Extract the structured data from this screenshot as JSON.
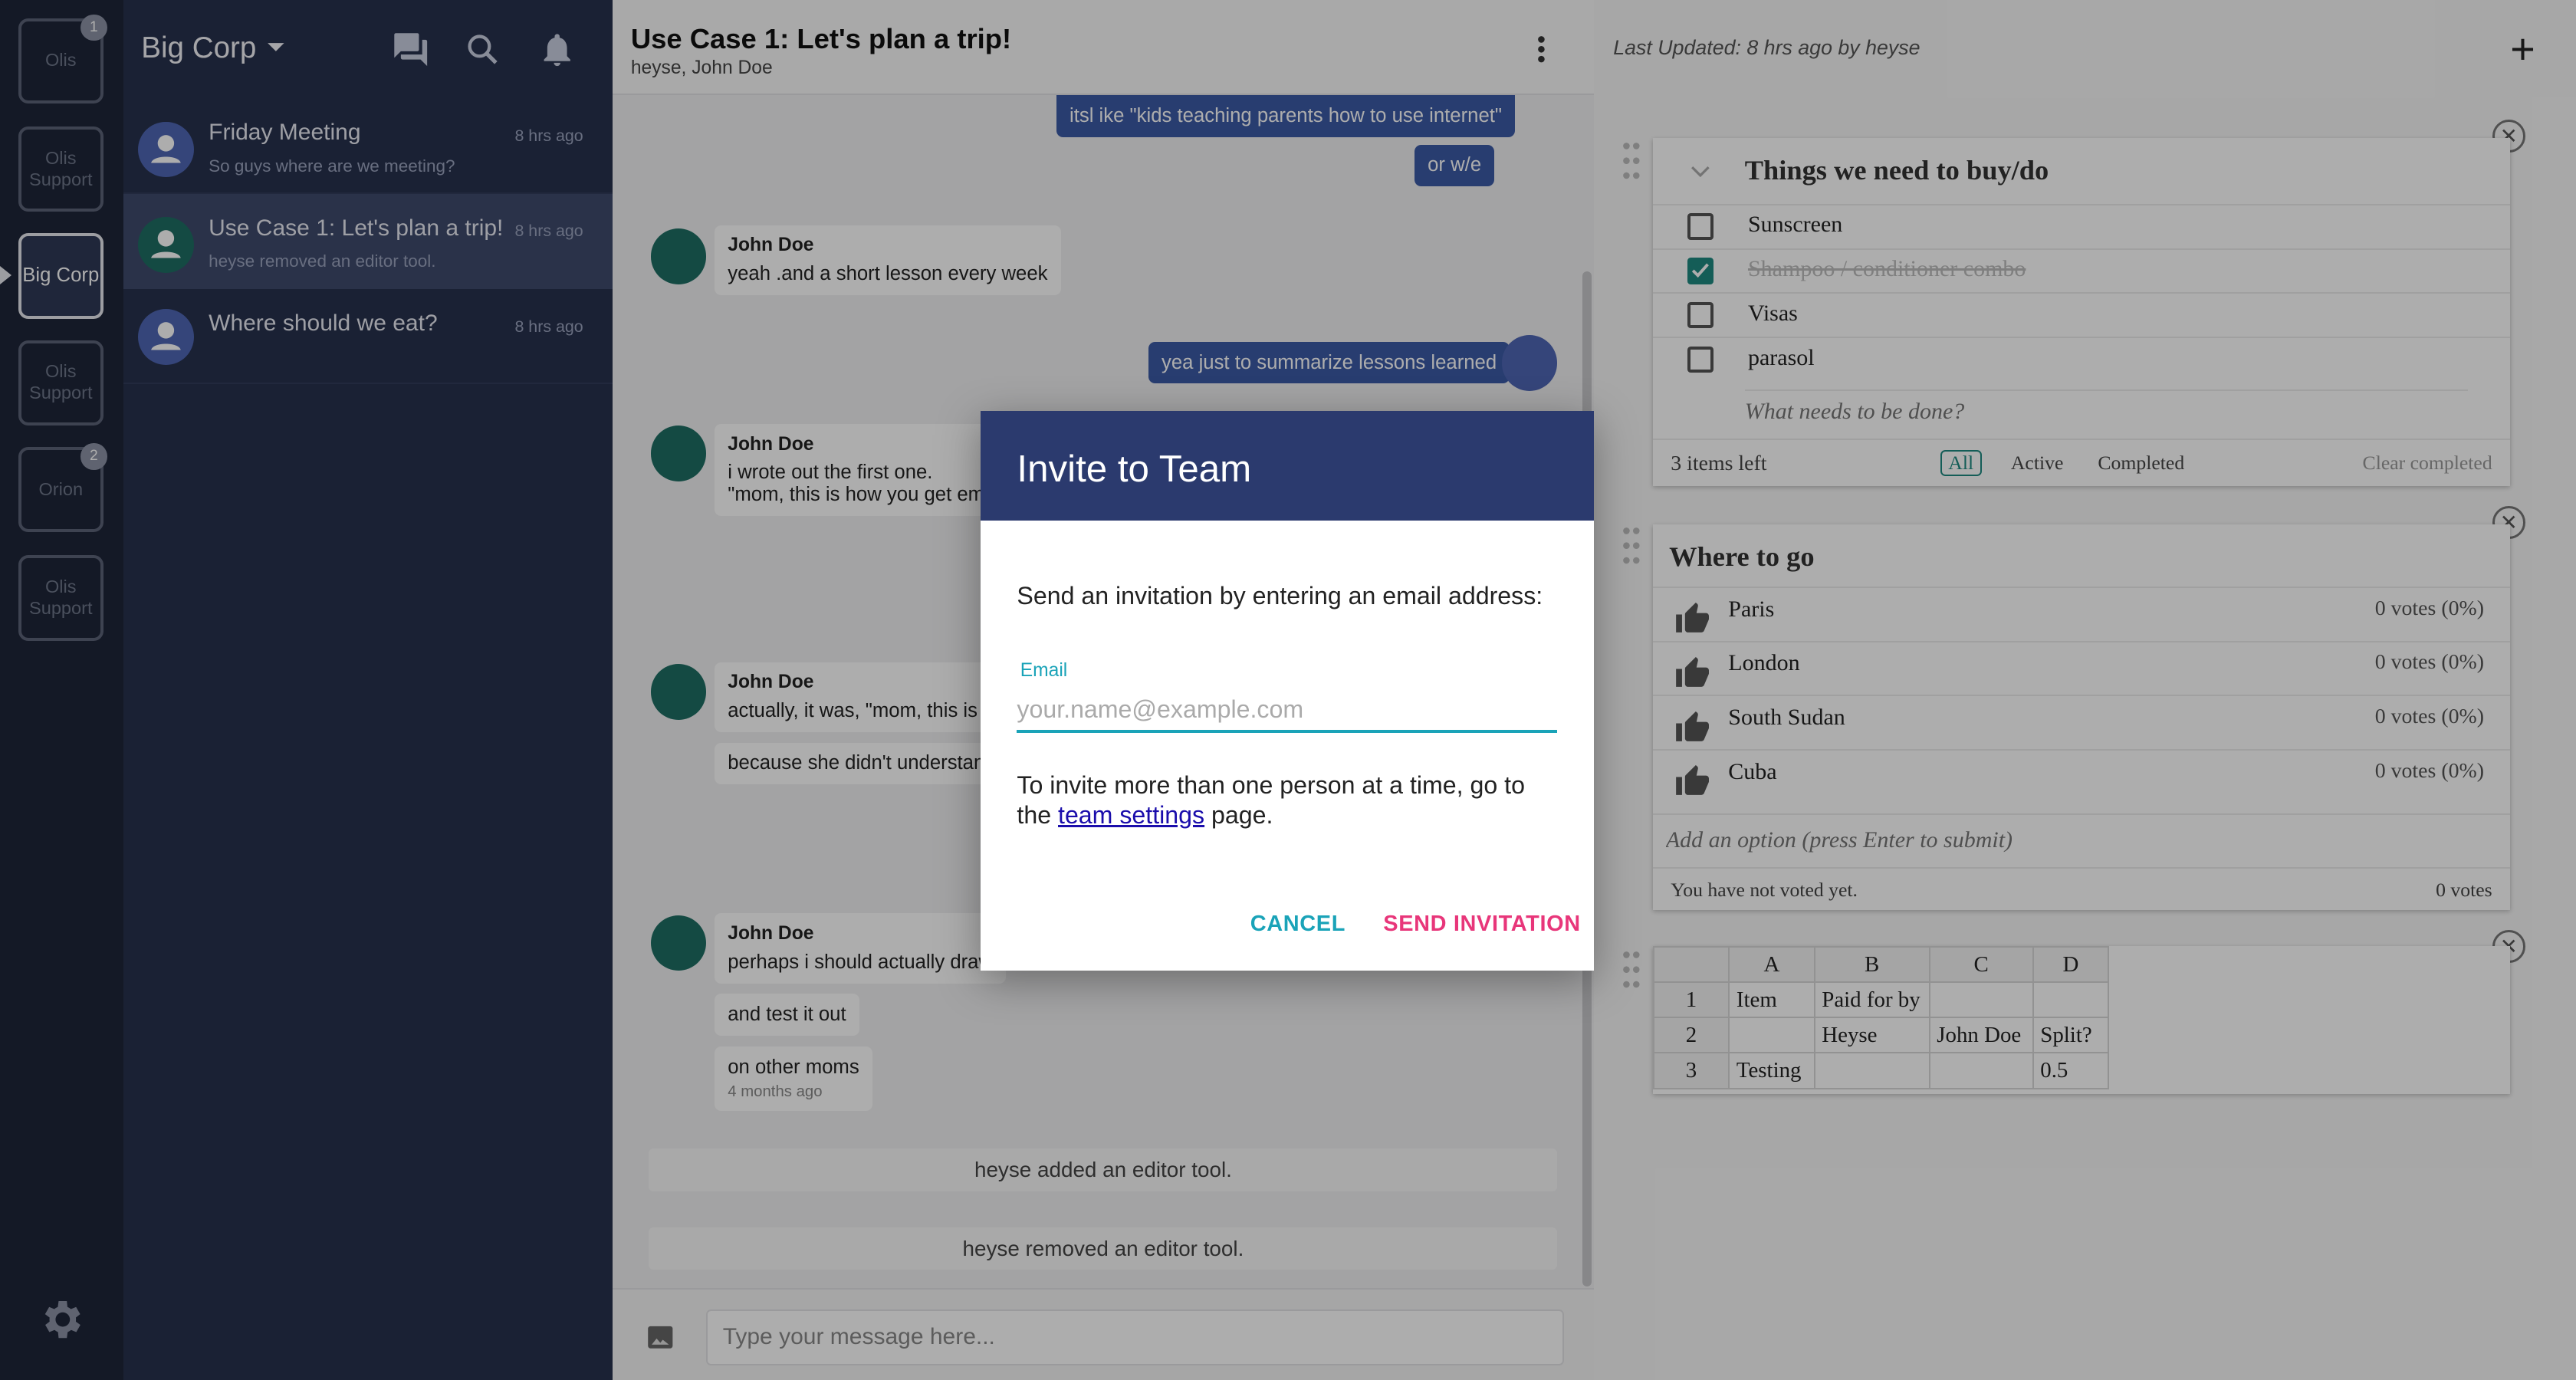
{
  "teams": [
    {
      "label": "Olis",
      "badge": "1"
    },
    {
      "label": "Olis Support",
      "badge": ""
    },
    {
      "label": "Big Corp",
      "badge": ""
    },
    {
      "label": "Olis Support",
      "badge": ""
    },
    {
      "label": "Orion",
      "badge": "2"
    },
    {
      "label": "Olis Support",
      "badge": ""
    }
  ],
  "sidebar": {
    "team_name": "Big Corp",
    "conversations": [
      {
        "name": "Friday Meeting",
        "preview": "So guys where are we meeting?",
        "time": "8 hrs ago"
      },
      {
        "name": "Use Case 1: Let's plan a trip!",
        "preview": "heyse removed an editor tool.",
        "time": "8 hrs ago"
      },
      {
        "name": "Where should we eat?",
        "preview": "",
        "time": "8 hrs ago"
      }
    ]
  },
  "chat": {
    "title": "Use Case 1: Let's plan a trip!",
    "members": "heyse, John Doe",
    "messages": {
      "m1": "itsl ike \"kids teaching parents how to use internet\"",
      "m2": "or w/e",
      "j1_name": "John Doe",
      "j1_text": "yeah .and a short lesson every week",
      "m3": "yea just to summarize lessons learned",
      "j2_name": "John Doe",
      "j2_line1": "i wrote out the first one.",
      "j2_line2": "\"mom, this is how you get ema",
      "j3_name": "John Doe",
      "j3_text": "actually, it was, \"mom, this is h",
      "j3_b2": "because she didn't understand",
      "j4_name": "John Doe",
      "j4_text": "perhaps i should actually draw",
      "j4_b2": "and test it out",
      "j4_b3": "on other moms",
      "j4_b3_time": "4 months ago",
      "sys1": "heyse added an editor tool.",
      "sys2": "heyse removed an editor tool."
    },
    "input_placeholder": "Type your message here..."
  },
  "panel": {
    "last_updated": "Last Updated: 8 hrs ago by heyse",
    "plus": "+",
    "close": "✕",
    "todo": {
      "title": "Things we need to buy/do",
      "items": [
        {
          "label": "Sunscreen",
          "done": false
        },
        {
          "label": "Shampoo / conditioner combo",
          "done": true
        },
        {
          "label": "Visas",
          "done": false
        },
        {
          "label": "parasol",
          "done": false
        }
      ],
      "new_placeholder": "What needs to be done?",
      "items_left": "3 items left",
      "filters": [
        "All",
        "Active",
        "Completed"
      ],
      "clear": "Clear completed"
    },
    "poll": {
      "title": "Where to go",
      "options": [
        {
          "label": "Paris",
          "votes": "0 votes (0%)"
        },
        {
          "label": "London",
          "votes": "0 votes (0%)"
        },
        {
          "label": "South Sudan",
          "votes": "0 votes (0%)"
        },
        {
          "label": "Cuba",
          "votes": "0 votes (0%)"
        }
      ],
      "add_placeholder": "Add an option (press Enter to submit)",
      "status": "You have not voted yet.",
      "total": "0 votes"
    },
    "sheet": {
      "cols": [
        "A",
        "B",
        "C",
        "D"
      ],
      "rows": [
        {
          "n": "1",
          "cells": [
            "Item",
            "Paid for by",
            "",
            ""
          ]
        },
        {
          "n": "2",
          "cells": [
            "",
            "Heyse",
            "John Doe",
            "Split?"
          ]
        },
        {
          "n": "3",
          "cells": [
            "Testing",
            "",
            "",
            "0.5"
          ]
        }
      ]
    }
  },
  "dialog": {
    "title": "Invite to Team",
    "body": "Send an invitation by entering an email address:",
    "email_label": "Email",
    "email_placeholder": "your.name@example.com",
    "note_before": "To invite more than one person at a time, go to the ",
    "note_link": "team settings",
    "note_after": " page.",
    "cancel": "CANCEL",
    "send": "SEND INVITATION"
  },
  "colors": {
    "accent": "#1aa3b8",
    "send": "#e8367a",
    "dialog_header": "#2b3a6e",
    "sidebar": "#27314d",
    "rail": "#1e2538"
  }
}
